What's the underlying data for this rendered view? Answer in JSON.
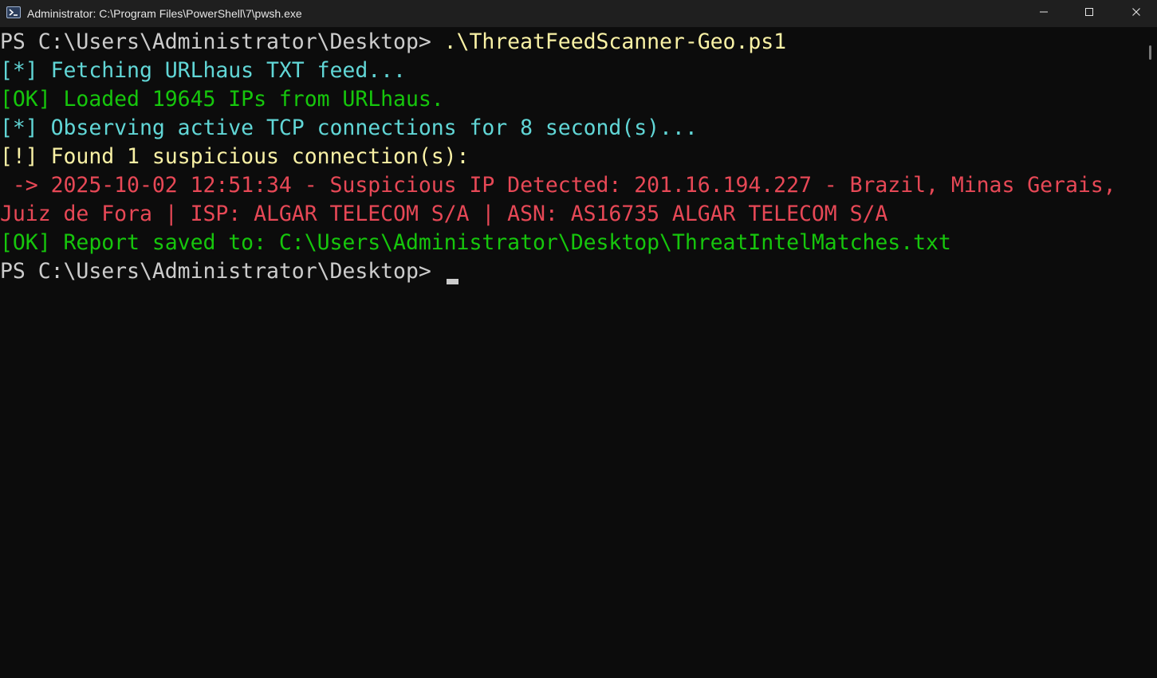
{
  "window": {
    "title": "Administrator: C:\\Program Files\\PowerShell\\7\\pwsh.exe",
    "icon": "powershell-icon",
    "controls": [
      "minimize-icon",
      "maximize-icon",
      "close-icon"
    ]
  },
  "terminal": {
    "lines": [
      {
        "prompt": "PS C:\\Users\\Administrator\\Desktop> ",
        "command": ".\\ThreatFeedScanner-Geo.ps1"
      },
      {
        "text": "[*] Fetching URLhaus TXT feed...",
        "color": "#61d6d6"
      },
      {
        "text": "[OK] Loaded 19645 IPs from URLhaus.",
        "color": "#16c60c"
      },
      {
        "text": "[*] Observing active TCP connections for 8 second(s)...",
        "color": "#61d6d6"
      },
      {
        "text": "[!] Found 1 suspicious connection(s):",
        "color": "#f9f1a5"
      },
      {
        "text": " -> 2025-10-02 12:51:34 - Suspicious IP Detected: 201.16.194.227 - Brazil, Minas Gerais,",
        "color": "#e74856"
      },
      {
        "text": "Juiz de Fora | ISP: ALGAR TELECOM S/A | ASN: AS16735 ALGAR TELECOM S/A",
        "color": "#e74856"
      },
      {
        "text": "[OK] Report saved to: C:\\Users\\Administrator\\Desktop\\ThreatIntelMatches.txt",
        "color": "#16c60c"
      },
      {
        "prompt": "PS C:\\Users\\Administrator\\Desktop> "
      }
    ]
  },
  "colors": {
    "background": "#0c0c0c",
    "titlebar": "#1f1f1f",
    "prompt": "#cccccc",
    "command": "#f9f1a5"
  }
}
